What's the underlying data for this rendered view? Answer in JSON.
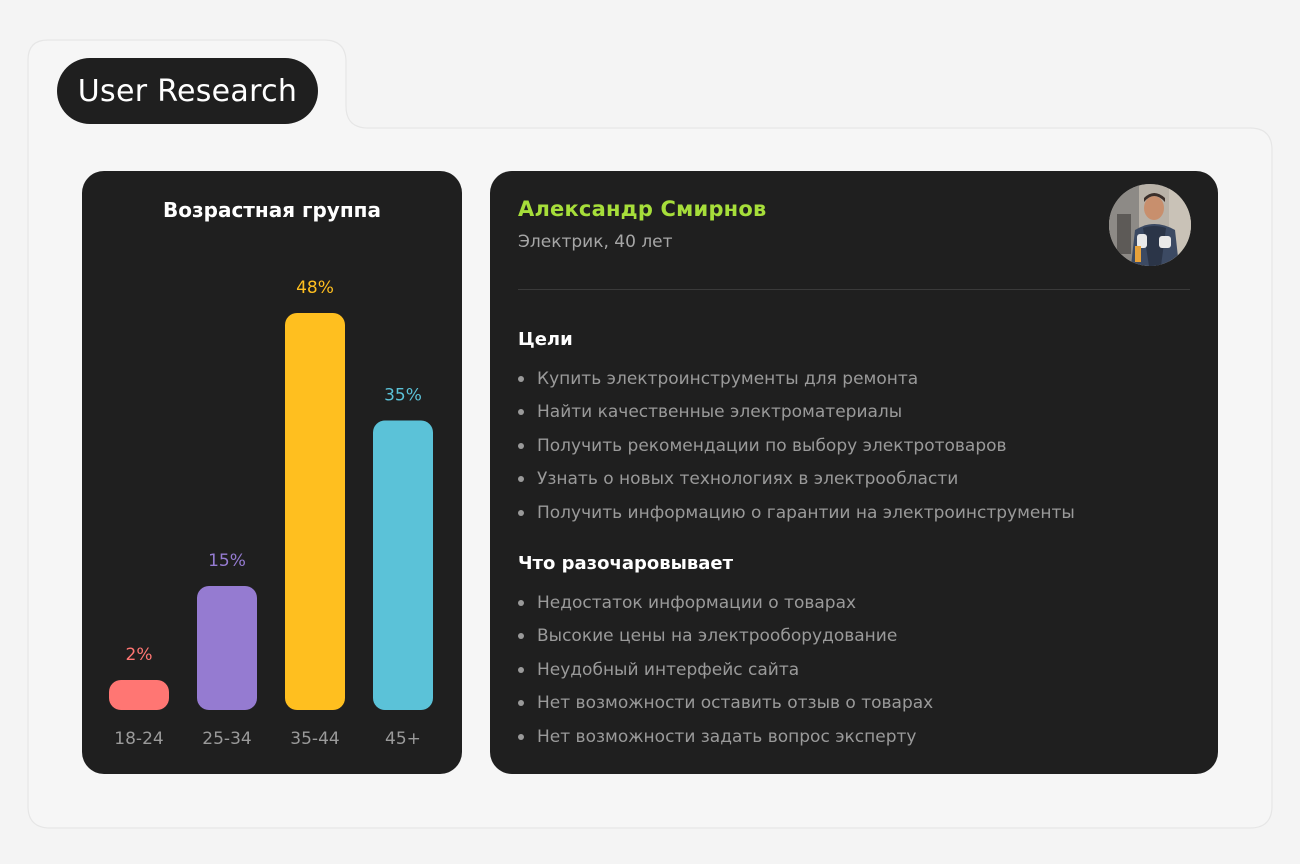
{
  "header": {
    "badge_label": "User Research"
  },
  "colors": {
    "page_bg": "#f4f4f4",
    "card_bg": "#1f1f1f",
    "accent_green": "#a6de3a",
    "muted_text": "#9a9a9a"
  },
  "chart_data": {
    "type": "bar",
    "title": "Возрастная группа",
    "categories": [
      "18-24",
      "25-34",
      "35-44",
      "45+"
    ],
    "values": [
      2,
      15,
      48,
      35
    ],
    "value_labels": [
      "2%",
      "15%",
      "48%",
      "35%"
    ],
    "colors": [
      "#ff7673",
      "#957bd1",
      "#ffbf1f",
      "#5bc2d8"
    ],
    "ylim": [
      0,
      48
    ],
    "grid": false
  },
  "persona": {
    "name": "Александр Смирнов",
    "role": "Электрик, 40 лет",
    "avatar_icon": "person-photo"
  },
  "goals": {
    "title": "Цели",
    "items": [
      "Купить электроинструменты для ремонта",
      "Найти качественные электроматериалы",
      "Получить рекомендации по выбору электротоваров",
      "Узнать о новых технологиях в электрообласти",
      "Получить информацию о гарантии на электроинструменты"
    ]
  },
  "frustrations": {
    "title": "Что разочаровывает",
    "items": [
      "Недостаток информации о товарах",
      "Высокие цены на электрооборудование",
      "Неудобный интерфейс сайта",
      "Нет возможности оставить отзыв о товарах",
      "Нет возможности задать вопрос эксперту"
    ]
  }
}
